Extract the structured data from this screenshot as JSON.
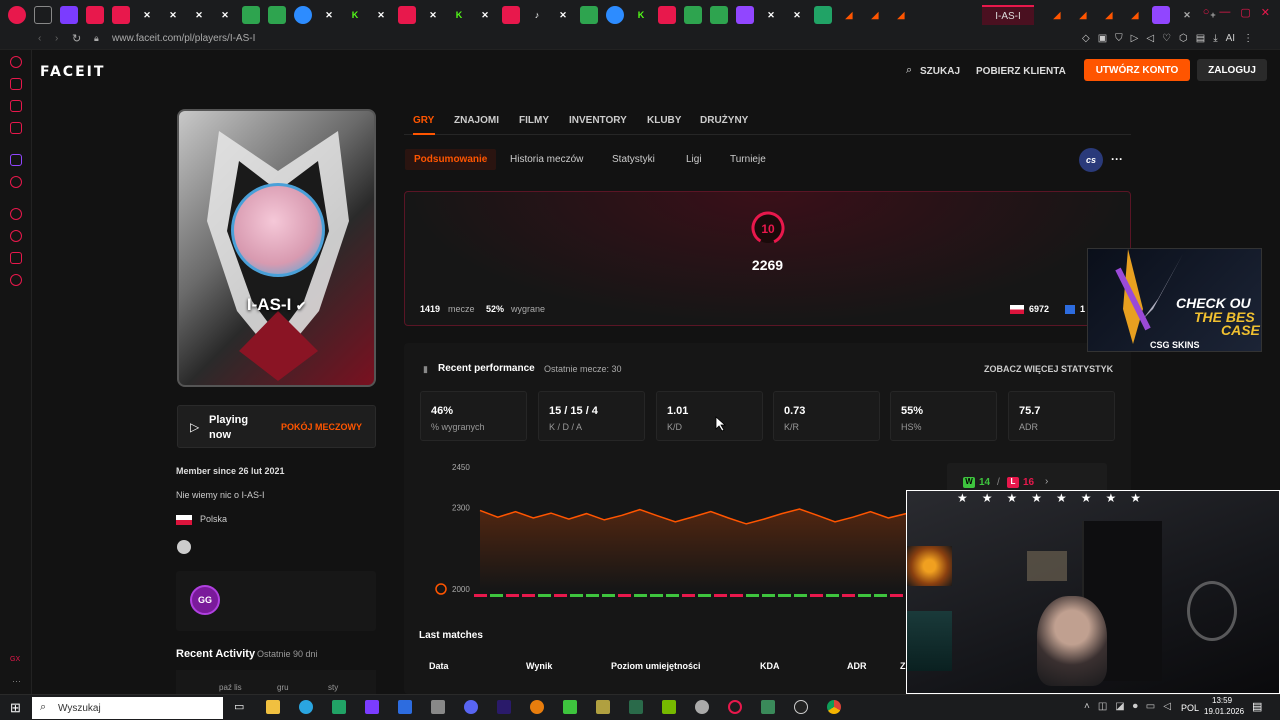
{
  "browser": {
    "active_tab": "I-AS-I",
    "url": "www.faceit.com/pl/players/I-AS-I"
  },
  "topnav": {
    "logo": "FACEIT",
    "search": "SZUKAJ",
    "download": "POBIERZ KLIENTA",
    "create_account": "UTWÓRZ KONTO",
    "login": "ZALOGUJ"
  },
  "profile": {
    "nickname": "I-AS-I",
    "playing_label": "Playing now",
    "match_room": "POKÓJ MECZOWY",
    "member_since": "Member since 26 lut 2021",
    "about": "Nie wiemy nic o I-AS-I",
    "country": "Polska",
    "recent_activity": "Recent Activity",
    "recent_activity_period": "Ostatnie 90 dni",
    "activity_cols": [
      "paź lis",
      "gru",
      "sty"
    ]
  },
  "tabs": {
    "main": [
      "GRY",
      "ZNAJOMI",
      "FILMY",
      "INVENTORY",
      "KLUBY",
      "DRUŻYNY"
    ],
    "sub": [
      "Podsumowanie",
      "Historia meczów",
      "Statystyki",
      "Ligi",
      "Turnieje"
    ],
    "game_badge": "cs"
  },
  "summary": {
    "level": "10",
    "elo": "2269",
    "matches_count": "1419",
    "matches_label": "mecze",
    "win_pct": "52%",
    "win_label": "wygrane",
    "country_rank": "6972",
    "region_rank": "1"
  },
  "performance": {
    "title": "Recent performance",
    "subtitle": "Ostatnie mecze: 30",
    "more_link": "ZOBACZ WIĘCEJ STATYSTYK",
    "stats": [
      {
        "value": "46%",
        "label": "% wygranych"
      },
      {
        "value": "15 / 15 / 4",
        "label": "K / D / A"
      },
      {
        "value": "1.01",
        "label": "K/D"
      },
      {
        "value": "0.73",
        "label": "K/R"
      },
      {
        "value": "55%",
        "label": "HS%"
      },
      {
        "value": "75.7",
        "label": "ADR"
      }
    ],
    "wins": "14",
    "losses": "16",
    "w_label": "W",
    "l_label": "L"
  },
  "chart_data": {
    "type": "line",
    "title": "",
    "xlabel": "",
    "ylabel": "",
    "yticks": [
      2450,
      2300,
      2000
    ],
    "ylim": [
      2000,
      2450
    ],
    "series": [
      {
        "values": [
          2290,
          2265,
          2285,
          2262,
          2280,
          2258,
          2278,
          2255,
          2272,
          2293,
          2270,
          2248,
          2266,
          2286,
          2262,
          2240,
          2258,
          2278,
          2295,
          2272,
          2248,
          2265,
          2285,
          2262,
          2278
        ]
      }
    ],
    "results": [
      "L",
      "W",
      "L",
      "L",
      "W",
      "L",
      "W",
      "W",
      "W",
      "L",
      "W",
      "W",
      "W",
      "L",
      "W",
      "L",
      "L",
      "W",
      "W",
      "W",
      "W",
      "L",
      "W",
      "L",
      "W",
      "W",
      "L"
    ]
  },
  "last_matches": {
    "title": "Last matches",
    "columns": [
      "Data",
      "Wynik",
      "Poziom umiejętności",
      "KDA",
      "ADR",
      "Z"
    ]
  },
  "ad": {
    "line1": "CHECK OU",
    "line2": "THE BES",
    "line3": "CASE",
    "brand": "CSG SKINS"
  },
  "taskbar": {
    "search_placeholder": "Wyszukaj",
    "lang": "POL",
    "time": "13:59",
    "date": "19.01.2026"
  },
  "colors": {
    "accent": "#ff5500",
    "brand": "#e8184c",
    "win": "#3ec43e",
    "loss": "#e8184c"
  }
}
